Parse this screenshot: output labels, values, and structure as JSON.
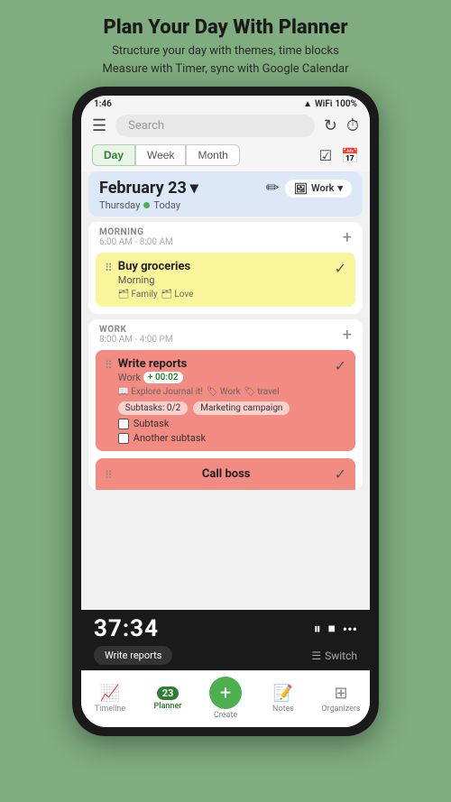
{
  "page": {
    "title": "Plan Your Day With Planner",
    "subtitle": "Structure your day with themes, time blocks\nMeasure with Timer, sync with Google Calendar"
  },
  "status_bar": {
    "time": "1:46",
    "battery": "100%",
    "icons": "signal wifi battery"
  },
  "top_nav": {
    "menu_icon": "☰",
    "search_placeholder": "Search",
    "refresh_icon": "↻",
    "timer_icon": "⏱"
  },
  "view_tabs": {
    "tabs": [
      "Day",
      "Week",
      "Month"
    ],
    "active": "Day",
    "check_icon": "✓",
    "calendar_icon": "📅"
  },
  "date_header": {
    "date": "February 23",
    "chevron": "▾",
    "day": "Thursday",
    "today": "Today",
    "edit_icon": "✏",
    "work_label": "Work",
    "work_icon": "🖼"
  },
  "morning_section": {
    "label": "MORNING",
    "time": "6:00 AM - 8:00 AM",
    "add_icon": "+",
    "task": {
      "title": "Buy groceries",
      "subtitle": "Morning",
      "tags": [
        "Family",
        "Love"
      ],
      "check": "✓",
      "drag": "⠿"
    }
  },
  "work_section": {
    "label": "WORK",
    "time": "8:00 AM - 4:00 PM",
    "add_icon": "+",
    "task": {
      "title": "Write reports",
      "subtitle": "Work",
      "time_badge": "+ 00:02",
      "tags": [
        "Explore Journal it!",
        "Work",
        "travel"
      ],
      "subtasks_label": "Subtasks: 0/2",
      "marketing_badge": "Marketing campaign",
      "subtask1": "Subtask",
      "subtask2": "Another subtask",
      "check": "✓",
      "drag": "⠿"
    }
  },
  "partial_task": {
    "title": "Call boss",
    "check": "✓",
    "drag": "⠿"
  },
  "timer": {
    "display": "37:34",
    "play_icon": "⏸",
    "stop_icon": "⏹",
    "more_icon": "•••",
    "task_label": "Write reports",
    "switch_icon": "☰",
    "switch_label": "Switch"
  },
  "bottom_nav": {
    "items": [
      {
        "icon": "📈",
        "label": "Timeline",
        "active": false
      },
      {
        "icon": "23",
        "label": "Planner",
        "active": true
      },
      {
        "icon": "+",
        "label": "Create",
        "active": false
      },
      {
        "icon": "📝",
        "label": "Notes",
        "active": false
      },
      {
        "icon": "⊞",
        "label": "Organizers",
        "active": false
      }
    ]
  }
}
